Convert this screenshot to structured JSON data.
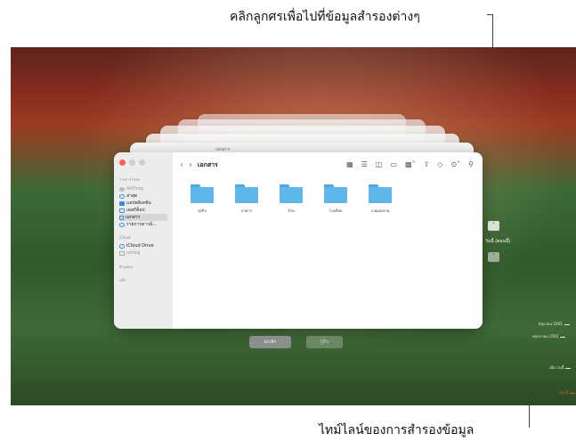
{
  "callouts": {
    "top": "คลิกลูกศรเพื่อไปที่ข้อมูลสำรองต่างๆ",
    "bottom": "ไทม์ไลน์ของการสำรองข้อมูล"
  },
  "finder": {
    "title": "เอกสาร",
    "stacked_title": "เอกสาร",
    "nav_back": "‹",
    "nav_forward": "›",
    "sidebar": {
      "favorites_header": "รายการโปรด",
      "items": [
        {
          "label": "AirDrop",
          "icon": "airdrop-icon",
          "muted": true
        },
        {
          "label": "ล่าสุด",
          "icon": "clock-icon"
        },
        {
          "label": "แอปพลิเคชั่น",
          "icon": "applications-icon"
        },
        {
          "label": "เดสก์ท็อป",
          "icon": "desktop-icon"
        },
        {
          "label": "เอกสาร",
          "icon": "document-icon",
          "active": true
        },
        {
          "label": "รายการดาวน์...",
          "icon": "download-icon"
        }
      ],
      "icloud_header": "iCloud",
      "icloud_items": [
        {
          "label": "iCloud Drive",
          "icon": "cloud-icon"
        },
        {
          "label": "แชร์อยู่",
          "icon": "shared-folder-icon",
          "muted": true
        }
      ],
      "locations_header": "ตำแหน่ง",
      "tags_header": "แท็ก"
    },
    "folders": [
      {
        "label": "ธุรกิจ"
      },
      {
        "label": "อาหาร"
      },
      {
        "label": "บ้าน"
      },
      {
        "label": "โรงเรียน"
      },
      {
        "label": "งานแต่งงาน"
      }
    ]
  },
  "buttons": {
    "cancel": "ยกเลิก",
    "restore": "กู้คืน"
  },
  "time_machine": {
    "now_label": "วันนี้ (ตอนนี้)",
    "timeline": [
      "มิถุนายน 2565",
      "พฤษภาคม 2565",
      "เมื่อวานนี้",
      "ตอนนี้"
    ]
  },
  "colors": {
    "folder_blue": "#5fb6ea",
    "close_red": "#ff5f57",
    "timeline_now": "#e05040"
  }
}
